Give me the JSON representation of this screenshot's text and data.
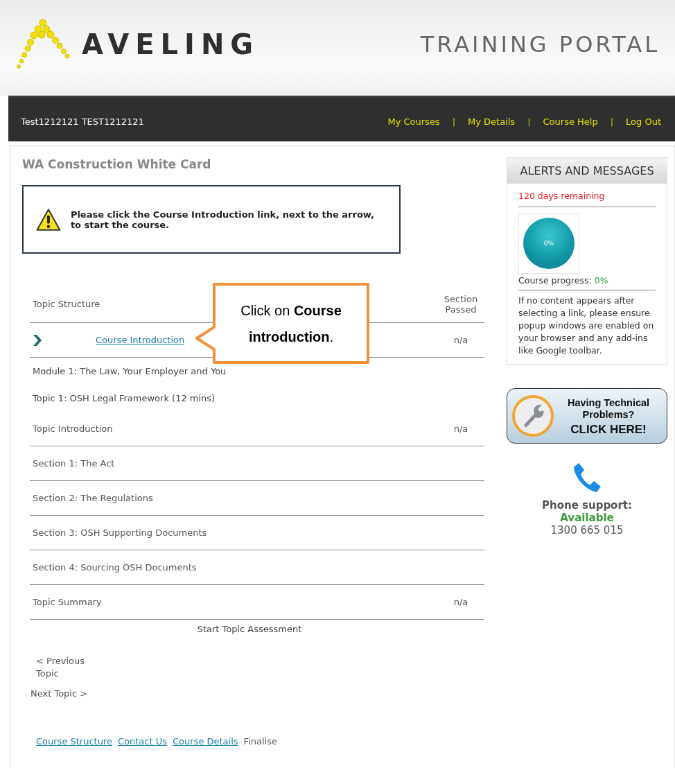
{
  "header": {
    "brand": "AVELING",
    "portal_title": "TRAINING PORTAL"
  },
  "nav": {
    "user": "Test1212121 TEST1212121",
    "separator": "|",
    "links": [
      "My Courses",
      "My Details",
      "Course Help",
      "Log Out"
    ]
  },
  "course": {
    "title": "WA Construction White Card",
    "notice": "Please click the Course Introduction link, next to the arrow, to start the course.",
    "columns": [
      "Topic Structure",
      "Section Passed"
    ],
    "rows": [
      {
        "kind": "link",
        "label": "Course Introduction",
        "passed": "n/a"
      },
      {
        "kind": "heading",
        "label": "Module 1: The Law, Your Employer and You"
      },
      {
        "kind": "heading",
        "label": "Topic 1: OSH Legal Framework (12 mins)"
      },
      {
        "kind": "item",
        "label": "Topic Introduction",
        "passed": "n/a"
      },
      {
        "kind": "item",
        "label": "Section 1: The Act"
      },
      {
        "kind": "item",
        "label": "Section 2: The Regulations"
      },
      {
        "kind": "item",
        "label": "Section 3: OSH Supporting Documents"
      },
      {
        "kind": "item",
        "label": "Section 4: Sourcing OSH Documents"
      },
      {
        "kind": "item",
        "label": "Topic Summary",
        "passed": "n/a"
      }
    ],
    "assessment": "Start Topic Assessment",
    "previous": "< Previous Topic",
    "next": "Next Topic >",
    "footer_links": [
      {
        "kind": "link",
        "label": "Course Structure"
      },
      {
        "kind": "link",
        "label": "Contact Us"
      },
      {
        "kind": "link",
        "label": "Course Details"
      },
      {
        "kind": "text",
        "label": "Finalise"
      }
    ],
    "callout": "Click on **Course introduction**."
  },
  "sidebar": {
    "alerts_title": "ALERTS AND MESSAGES",
    "days_remaining": "120 days remaining",
    "progress_badge": "0%",
    "progress_label": "Course progress:",
    "progress_value": "0%",
    "popup_note": "If no content appears after selecting a link, please ensure popup windows are enabled on your browser and any add-ins like Google toolbar.",
    "tech_help": [
      "Having Technical Problems?",
      "CLICK HERE!"
    ],
    "phone_label": "Phone support:",
    "phone_status": "Available",
    "phone_number": "1300 665 015"
  }
}
